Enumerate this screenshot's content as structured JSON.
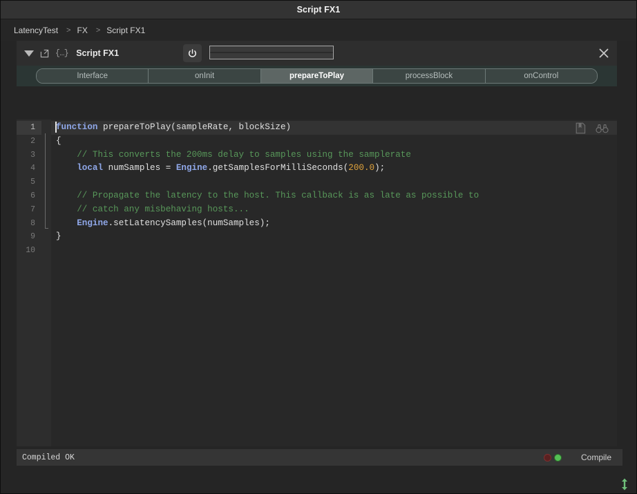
{
  "window": {
    "title": "Script FX1"
  },
  "breadcrumb": {
    "items": [
      "LatencyTest",
      "FX",
      "Script FX1"
    ],
    "separator": ">"
  },
  "module": {
    "name": "Script FX1",
    "icons": {
      "collapse": "triangle-down-icon",
      "popout": "external-link-icon",
      "braces": "{…}",
      "power": "power-icon",
      "close": "close-icon"
    },
    "meter_value": ""
  },
  "tabs": [
    {
      "label": "Interface",
      "active": false
    },
    {
      "label": "onInit",
      "active": false
    },
    {
      "label": "prepareToPlay",
      "active": true
    },
    {
      "label": "processBlock",
      "active": false
    },
    {
      "label": "onControl",
      "active": false
    }
  ],
  "editor": {
    "tools": [
      "bookmark-icon",
      "binoculars-search-icon"
    ],
    "line_numbers": [
      "1",
      "2",
      "3",
      "4",
      "5",
      "6",
      "7",
      "8",
      "9",
      "10"
    ],
    "current_line": 1,
    "lines": [
      {
        "n": 1,
        "tokens": [
          {
            "t": "function",
            "c": "kw"
          },
          {
            "t": " prepareToPlay(sampleRate, blockSize)",
            "c": ""
          }
        ]
      },
      {
        "n": 2,
        "tokens": [
          {
            "t": "{",
            "c": ""
          }
        ]
      },
      {
        "n": 3,
        "tokens": [
          {
            "t": "    // This converts the 200ms delay to samples using the samplerate",
            "c": "cmt"
          }
        ]
      },
      {
        "n": 4,
        "tokens": [
          {
            "t": "    ",
            "c": ""
          },
          {
            "t": "local",
            "c": "kw"
          },
          {
            "t": " numSamples = ",
            "c": ""
          },
          {
            "t": "Engine",
            "c": "kw"
          },
          {
            "t": ".getSamplesForMilliSeconds(",
            "c": ""
          },
          {
            "t": "200.0",
            "c": "num"
          },
          {
            "t": ");",
            "c": ""
          }
        ]
      },
      {
        "n": 5,
        "tokens": [
          {
            "t": "",
            "c": ""
          }
        ]
      },
      {
        "n": 6,
        "tokens": [
          {
            "t": "    // Propagate the latency to the host. This callback is as late as possible to",
            "c": "cmt"
          }
        ]
      },
      {
        "n": 7,
        "tokens": [
          {
            "t": "    // catch any misbehaving hosts...",
            "c": "cmt"
          }
        ]
      },
      {
        "n": 8,
        "tokens": [
          {
            "t": "    ",
            "c": ""
          },
          {
            "t": "Engine",
            "c": "kw"
          },
          {
            "t": ".setLatencySamples(numSamples);",
            "c": ""
          }
        ]
      },
      {
        "n": 9,
        "tokens": [
          {
            "t": "}",
            "c": ""
          }
        ]
      },
      {
        "n": 10,
        "tokens": [
          {
            "t": "",
            "c": ""
          }
        ]
      }
    ]
  },
  "status": {
    "message": "Compiled OK",
    "compile_label": "Compile",
    "leds": [
      {
        "name": "error-led",
        "color": "#5a2020",
        "state": "off"
      },
      {
        "name": "success-led",
        "color": "#54c054",
        "state": "on"
      }
    ]
  },
  "colors": {
    "keyword": "#8fa7e8",
    "comment": "#58985a",
    "number": "#e0a33c",
    "text": "#e0e0e0",
    "tab_active_bg": "#5d6664",
    "tabbar_bg": "#2b3634"
  },
  "resize_grip": "vertical-resize-icon"
}
